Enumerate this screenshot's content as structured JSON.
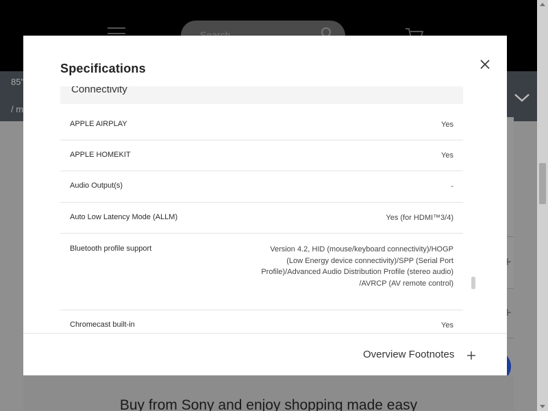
{
  "background": {
    "search_placeholder": "Search",
    "model_text": "85\"",
    "breadcrumb_text": "/ m",
    "promo_text": "Buy from Sony and enjoy shopping made easy"
  },
  "modal": {
    "title": "Specifications",
    "section": "Connectivity",
    "specs": [
      {
        "label": "APPLE AIRPLAY",
        "value": "Yes"
      },
      {
        "label": "APPLE HOMEKIT",
        "value": "Yes"
      },
      {
        "label": "Audio Output(s)",
        "value": "-"
      },
      {
        "label": "Auto Low Latency Mode (ALLM)",
        "value": "Yes (for HDMI™3/4)"
      },
      {
        "label": "Bluetooth profile support",
        "value": "Version 4.2, HID (mouse/keyboard connectivity)/HOGP (Low Energy device connectivity)/SPP (Serial Port Profile)/Advanced Audio Distribution Profile (stereo audio) /AVRCP (AV remote control)"
      },
      {
        "label": "Chromecast built-in",
        "value": "Yes"
      }
    ],
    "footer_label": "Overview Footnotes"
  },
  "icons": {
    "close": "close-icon",
    "plus": "plus-icon",
    "search": "search-icon",
    "cart": "cart-icon",
    "menu": "menu-icon",
    "chevron": "chevron-down-icon"
  },
  "colors": {
    "header": "#000000",
    "subbar": "#3a3f45",
    "overlay": "#8f8f8f",
    "fab": "#1a3d9a"
  }
}
